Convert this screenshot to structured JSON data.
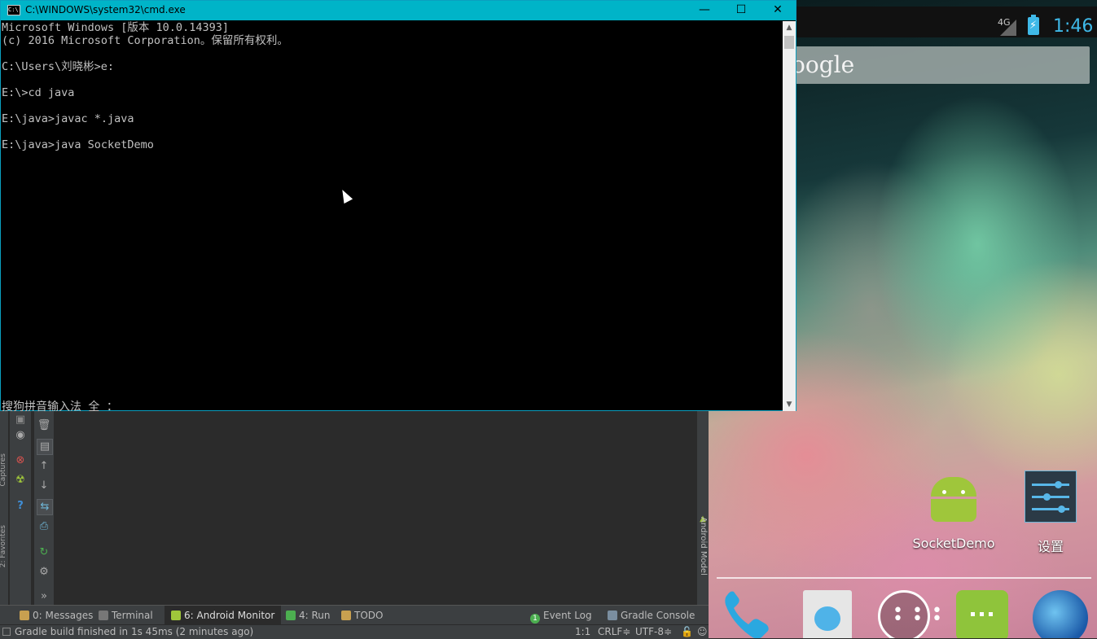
{
  "cmd": {
    "title": "C:\\WINDOWS\\system32\\cmd.exe",
    "icon_text": "C:\\",
    "minimize_glyph": "—",
    "maximize_glyph": "☐",
    "close_glyph": "✕",
    "lines": [
      "Microsoft Windows [版本 10.0.14393]",
      "(c) 2016 Microsoft Corporation。保留所有权利。",
      "",
      "C:\\Users\\刘晓彬>e:",
      "",
      "E:\\>cd java",
      "",
      "E:\\java>javac *.java",
      "",
      "E:\\java>java SocketDemo"
    ],
    "ime_status": "搜狗拼音输入法 全 ："
  },
  "emulator": {
    "network": "4G",
    "battery_glyph": "⚡",
    "clock": "1:46",
    "search_logo": "oogle",
    "apps": [
      {
        "label": "SocketDemo",
        "icon": "android-app-icon"
      },
      {
        "label": "设置",
        "icon": "settings-icon"
      }
    ],
    "dock": [
      "phone-icon",
      "contacts-icon",
      "all-apps-icon",
      "messaging-icon",
      "browser-icon"
    ],
    "all_apps_glyph": "• • •\n• • •"
  },
  "studio": {
    "left_strip_labels": [
      "Captures",
      "2: Favorites"
    ],
    "right_strip_label": "Android Model",
    "tabs": [
      {
        "label": "0: Messages",
        "icon_color": "#c8a050"
      },
      {
        "label": "Terminal",
        "icon_color": "#777777"
      },
      {
        "label": "6: Android Monitor",
        "icon_color": "#9fc63b"
      },
      {
        "label": "4: Run",
        "icon_color": "#4caf50"
      },
      {
        "label": "TODO",
        "icon_color": "#c8a050"
      },
      {
        "label": "Event Log",
        "icon_color": "#4caf50",
        "badge": "1"
      },
      {
        "label": "Gradle Console",
        "icon_color": "#7a8ea0"
      }
    ],
    "status_message": "Gradle build finished in 1s 45ms (2 minutes ago)",
    "position": "1:1",
    "line_sep": "CRLF≑",
    "encoding": "UTF-8≑"
  },
  "colors": {
    "cmd_titlebar": "#00b4c8",
    "emu_accent": "#3fb9e8",
    "android_green": "#9fc63b",
    "studio_bg": "#2b2b2b"
  }
}
